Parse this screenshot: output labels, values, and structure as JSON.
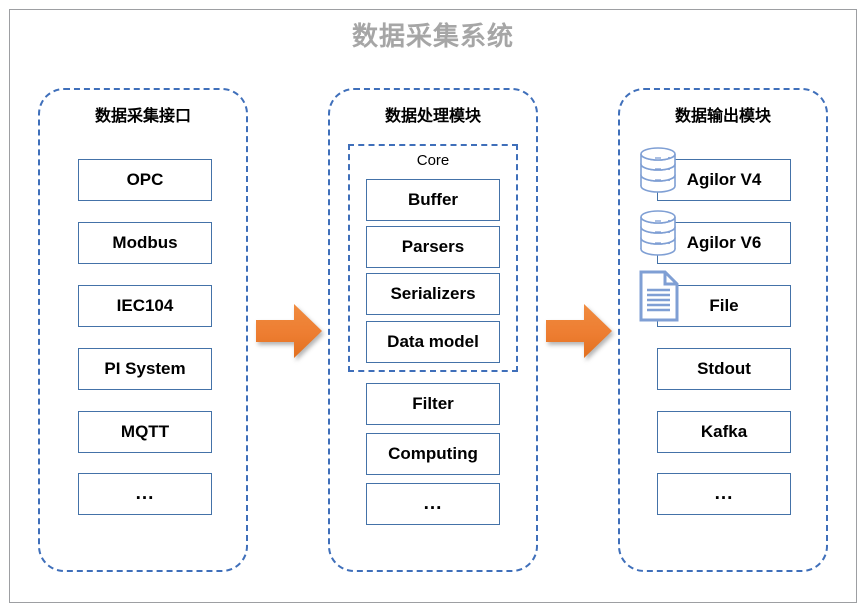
{
  "title": "数据采集系统",
  "theme": {
    "dashed_border": "#3f6fba",
    "box_border": "#4472a8",
    "arrow_orange": "#ed7d31",
    "title_gray": "#a6a6a6",
    "icon_blue": "#7f9fd4",
    "page_frame": "#9d9fa2"
  },
  "columns": [
    {
      "id": "input",
      "title": "数据采集接口",
      "items": [
        {
          "label": "OPC",
          "icon": null
        },
        {
          "label": "Modbus",
          "icon": null
        },
        {
          "label": "IEC104",
          "icon": null
        },
        {
          "label": "PI System",
          "icon": null
        },
        {
          "label": "MQTT",
          "icon": null
        },
        {
          "label": "...",
          "icon": null
        }
      ]
    },
    {
      "id": "process",
      "title": "数据处理模块",
      "group": {
        "label": "Core",
        "items": [
          {
            "label": "Buffer"
          },
          {
            "label": "Parsers"
          },
          {
            "label": "Serializers"
          },
          {
            "label": "Data model"
          }
        ]
      },
      "items": [
        {
          "label": "Filter",
          "icon": null
        },
        {
          "label": "Computing",
          "icon": null
        },
        {
          "label": "...",
          "icon": null
        }
      ]
    },
    {
      "id": "output",
      "title": "数据输出模块",
      "items": [
        {
          "label": "Agilor V4",
          "icon": "database-icon"
        },
        {
          "label": "Agilor V6",
          "icon": "database-icon"
        },
        {
          "label": "File",
          "icon": "document-icon"
        },
        {
          "label": "Stdout",
          "icon": null
        },
        {
          "label": "Kafka",
          "icon": null
        },
        {
          "label": "...",
          "icon": null
        }
      ]
    }
  ],
  "arrows": [
    {
      "name": "arrow-input-to-process",
      "icon": "right-arrow-icon"
    },
    {
      "name": "arrow-process-to-output",
      "icon": "right-arrow-icon"
    }
  ]
}
